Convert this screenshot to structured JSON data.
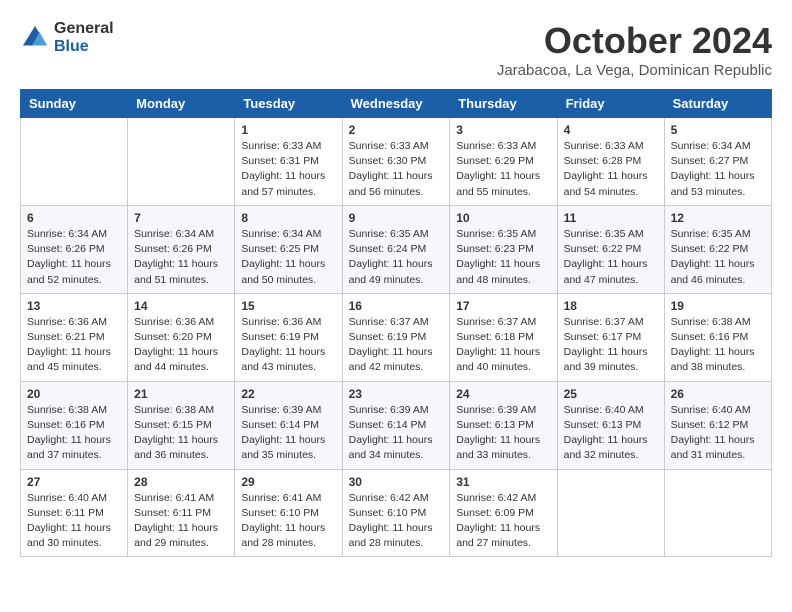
{
  "header": {
    "logo_general": "General",
    "logo_blue": "Blue",
    "month_year": "October 2024",
    "location": "Jarabacoa, La Vega, Dominican Republic"
  },
  "weekdays": [
    "Sunday",
    "Monday",
    "Tuesday",
    "Wednesday",
    "Thursday",
    "Friday",
    "Saturday"
  ],
  "weeks": [
    [
      {
        "day": "",
        "info": ""
      },
      {
        "day": "",
        "info": ""
      },
      {
        "day": "1",
        "info": "Sunrise: 6:33 AM\nSunset: 6:31 PM\nDaylight: 11 hours and 57 minutes."
      },
      {
        "day": "2",
        "info": "Sunrise: 6:33 AM\nSunset: 6:30 PM\nDaylight: 11 hours and 56 minutes."
      },
      {
        "day": "3",
        "info": "Sunrise: 6:33 AM\nSunset: 6:29 PM\nDaylight: 11 hours and 55 minutes."
      },
      {
        "day": "4",
        "info": "Sunrise: 6:33 AM\nSunset: 6:28 PM\nDaylight: 11 hours and 54 minutes."
      },
      {
        "day": "5",
        "info": "Sunrise: 6:34 AM\nSunset: 6:27 PM\nDaylight: 11 hours and 53 minutes."
      }
    ],
    [
      {
        "day": "6",
        "info": "Sunrise: 6:34 AM\nSunset: 6:26 PM\nDaylight: 11 hours and 52 minutes."
      },
      {
        "day": "7",
        "info": "Sunrise: 6:34 AM\nSunset: 6:26 PM\nDaylight: 11 hours and 51 minutes."
      },
      {
        "day": "8",
        "info": "Sunrise: 6:34 AM\nSunset: 6:25 PM\nDaylight: 11 hours and 50 minutes."
      },
      {
        "day": "9",
        "info": "Sunrise: 6:35 AM\nSunset: 6:24 PM\nDaylight: 11 hours and 49 minutes."
      },
      {
        "day": "10",
        "info": "Sunrise: 6:35 AM\nSunset: 6:23 PM\nDaylight: 11 hours and 48 minutes."
      },
      {
        "day": "11",
        "info": "Sunrise: 6:35 AM\nSunset: 6:22 PM\nDaylight: 11 hours and 47 minutes."
      },
      {
        "day": "12",
        "info": "Sunrise: 6:35 AM\nSunset: 6:22 PM\nDaylight: 11 hours and 46 minutes."
      }
    ],
    [
      {
        "day": "13",
        "info": "Sunrise: 6:36 AM\nSunset: 6:21 PM\nDaylight: 11 hours and 45 minutes."
      },
      {
        "day": "14",
        "info": "Sunrise: 6:36 AM\nSunset: 6:20 PM\nDaylight: 11 hours and 44 minutes."
      },
      {
        "day": "15",
        "info": "Sunrise: 6:36 AM\nSunset: 6:19 PM\nDaylight: 11 hours and 43 minutes."
      },
      {
        "day": "16",
        "info": "Sunrise: 6:37 AM\nSunset: 6:19 PM\nDaylight: 11 hours and 42 minutes."
      },
      {
        "day": "17",
        "info": "Sunrise: 6:37 AM\nSunset: 6:18 PM\nDaylight: 11 hours and 40 minutes."
      },
      {
        "day": "18",
        "info": "Sunrise: 6:37 AM\nSunset: 6:17 PM\nDaylight: 11 hours and 39 minutes."
      },
      {
        "day": "19",
        "info": "Sunrise: 6:38 AM\nSunset: 6:16 PM\nDaylight: 11 hours and 38 minutes."
      }
    ],
    [
      {
        "day": "20",
        "info": "Sunrise: 6:38 AM\nSunset: 6:16 PM\nDaylight: 11 hours and 37 minutes."
      },
      {
        "day": "21",
        "info": "Sunrise: 6:38 AM\nSunset: 6:15 PM\nDaylight: 11 hours and 36 minutes."
      },
      {
        "day": "22",
        "info": "Sunrise: 6:39 AM\nSunset: 6:14 PM\nDaylight: 11 hours and 35 minutes."
      },
      {
        "day": "23",
        "info": "Sunrise: 6:39 AM\nSunset: 6:14 PM\nDaylight: 11 hours and 34 minutes."
      },
      {
        "day": "24",
        "info": "Sunrise: 6:39 AM\nSunset: 6:13 PM\nDaylight: 11 hours and 33 minutes."
      },
      {
        "day": "25",
        "info": "Sunrise: 6:40 AM\nSunset: 6:13 PM\nDaylight: 11 hours and 32 minutes."
      },
      {
        "day": "26",
        "info": "Sunrise: 6:40 AM\nSunset: 6:12 PM\nDaylight: 11 hours and 31 minutes."
      }
    ],
    [
      {
        "day": "27",
        "info": "Sunrise: 6:40 AM\nSunset: 6:11 PM\nDaylight: 11 hours and 30 minutes."
      },
      {
        "day": "28",
        "info": "Sunrise: 6:41 AM\nSunset: 6:11 PM\nDaylight: 11 hours and 29 minutes."
      },
      {
        "day": "29",
        "info": "Sunrise: 6:41 AM\nSunset: 6:10 PM\nDaylight: 11 hours and 28 minutes."
      },
      {
        "day": "30",
        "info": "Sunrise: 6:42 AM\nSunset: 6:10 PM\nDaylight: 11 hours and 28 minutes."
      },
      {
        "day": "31",
        "info": "Sunrise: 6:42 AM\nSunset: 6:09 PM\nDaylight: 11 hours and 27 minutes."
      },
      {
        "day": "",
        "info": ""
      },
      {
        "day": "",
        "info": ""
      }
    ]
  ]
}
